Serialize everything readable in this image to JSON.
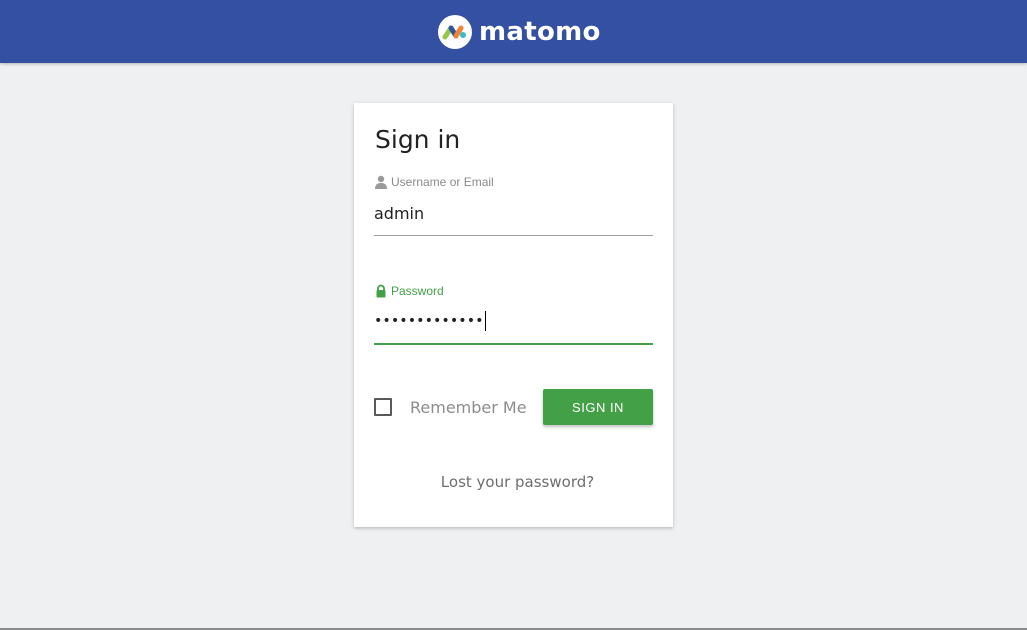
{
  "header": {
    "brand": "matomo",
    "logo_icon": "matomo-logo-icon",
    "background_color": "#3450a3"
  },
  "login": {
    "title": "Sign in",
    "username": {
      "label": "Username or Email",
      "value": "admin",
      "icon": "user-icon"
    },
    "password": {
      "label": "Password",
      "masked_value": "•••••••••••••",
      "icon": "lock-icon"
    },
    "remember_me": {
      "label": "Remember Me",
      "checked": false
    },
    "submit_label": "SIGN IN",
    "lost_password": "Lost your password?"
  },
  "colors": {
    "accent_green": "#43a047",
    "page_background": "#eef0f2"
  }
}
